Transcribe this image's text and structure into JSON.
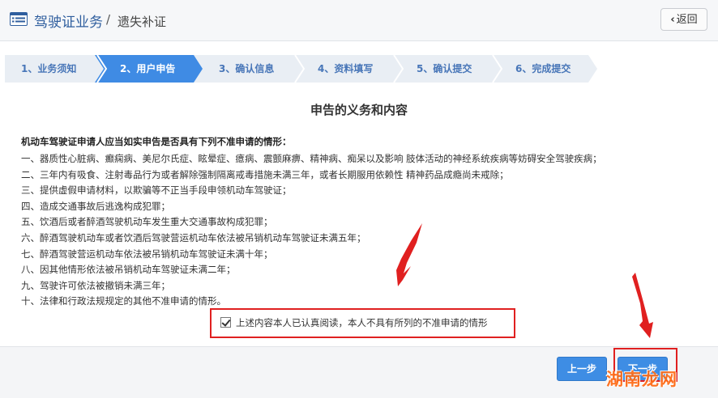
{
  "header": {
    "title": "驾驶证业务",
    "separator": "/",
    "subtitle": "遗失补证",
    "back_label": "返回"
  },
  "steps": [
    {
      "label": "1、业务须知",
      "active": false
    },
    {
      "label": "2、用户申告",
      "active": true
    },
    {
      "label": "3、确认信息",
      "active": false
    },
    {
      "label": "4、资料填写",
      "active": false
    },
    {
      "label": "5、确认提交",
      "active": false
    },
    {
      "label": "6、完成提交",
      "active": false
    }
  ],
  "main": {
    "title": "申告的义务和内容",
    "intro": "机动车驾驶证申请人应当如实申告是否具有下列不准申请的情形：",
    "clauses": [
      "一、器质性心脏病、癫痫病、美尼尔氏症、眩晕症、癔病、震颤麻痹、精神病、痴呆以及影响 肢体活动的神经系统疾病等妨碍安全驾驶疾病；",
      "二、三年内有吸食、注射毒品行为或者解除强制隔离戒毒措施未满三年，或者长期服用依赖性 精神药品成瘾尚未戒除；",
      "三、提供虚假申请材料，以欺骗等不正当手段申领机动车驾驶证；",
      "四、造成交通事故后逃逸构成犯罪；",
      "五、饮酒后或者醉酒驾驶机动车发生重大交通事故构成犯罪；",
      "六、醉酒驾驶机动车或者饮酒后驾驶营运机动车依法被吊销机动车驾驶证未满五年；",
      "七、醉酒驾驶营运机动车依法被吊销机动车驾驶证未满十年；",
      "八、因其他情形依法被吊销机动车驾驶证未满二年；",
      "九、驾驶许可依法被撤销未满三年；",
      "十、法律和行政法规规定的其他不准申请的情形。"
    ],
    "confirm_text": "上述内容本人已认真阅读，本人不具有所列的不准申请的情形",
    "confirm_checked": true
  },
  "footer": {
    "prev_label": "上一步",
    "next_label": "下一步"
  },
  "watermark": "湖南龙网",
  "colors": {
    "accent": "#3e8de4",
    "step_active": "#3f8be4",
    "step_inactive": "#e9eef4",
    "step_text": "#4876b8",
    "highlight": "#e02020",
    "watermark": "#ff6a13"
  }
}
